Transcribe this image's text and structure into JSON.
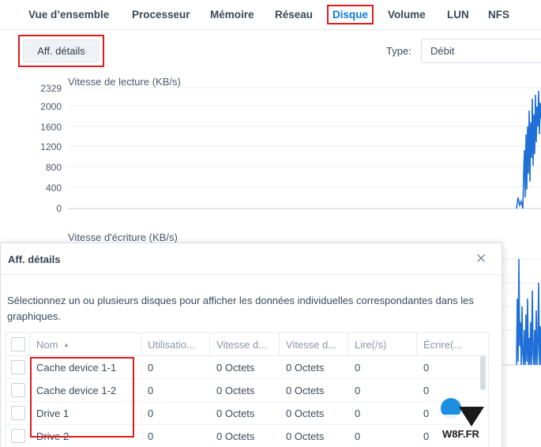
{
  "tabs": {
    "overview": "Vue d’ensemble",
    "processor": "Processeur",
    "memory": "Mémoire",
    "network": "Réseau",
    "disk": "Disque",
    "volume": "Volume",
    "lun": "LUN",
    "nfs": "NFS"
  },
  "toolbar": {
    "details_button": "Aff. détails",
    "type_label": "Type:",
    "type_value": "Débit"
  },
  "read_chart": {
    "title": "Vitesse de lecture (KB/s)",
    "y_ticks": [
      "2329",
      "2000",
      "1600",
      "1200",
      "800",
      "400",
      "0"
    ]
  },
  "write_chart": {
    "title": "Vitesse d'écriture (KB/s)"
  },
  "modal": {
    "title": "Aff. détails",
    "close_icon": "close-icon",
    "description": "Sélectionnez un ou plusieurs disques pour afficher les données individuelles correspondantes dans les graphiques.",
    "columns": [
      "Nom",
      "Utilisatio...",
      "Vitesse d...",
      "Vitesse d...",
      "Lire(/s)",
      "Écrire(..."
    ],
    "sort_icon": "sort-ascending-icon",
    "rows": [
      {
        "name": "Cache device 1-1",
        "util": "0",
        "speed_a": "0 Octets",
        "speed_b": "0 Octets",
        "read": "0",
        "write": "0"
      },
      {
        "name": "Cache device 1-2",
        "util": "0",
        "speed_a": "0 Octets",
        "speed_b": "0 Octets",
        "read": "0",
        "write": "0"
      },
      {
        "name": "Drive 1",
        "util": "0",
        "speed_a": "0 Octets",
        "speed_b": "0 Octets",
        "read": "0",
        "write": "0"
      },
      {
        "name": "Drive 2",
        "util": "0",
        "speed_a": "0 Octets",
        "speed_b": "0 Octets",
        "read": "0",
        "write": "0"
      }
    ]
  },
  "logo": {
    "text": "W8F.FR"
  },
  "colors": {
    "accent": "#0d7bd8",
    "highlight": "#e01b1b",
    "series": "#1f6fd6"
  }
}
